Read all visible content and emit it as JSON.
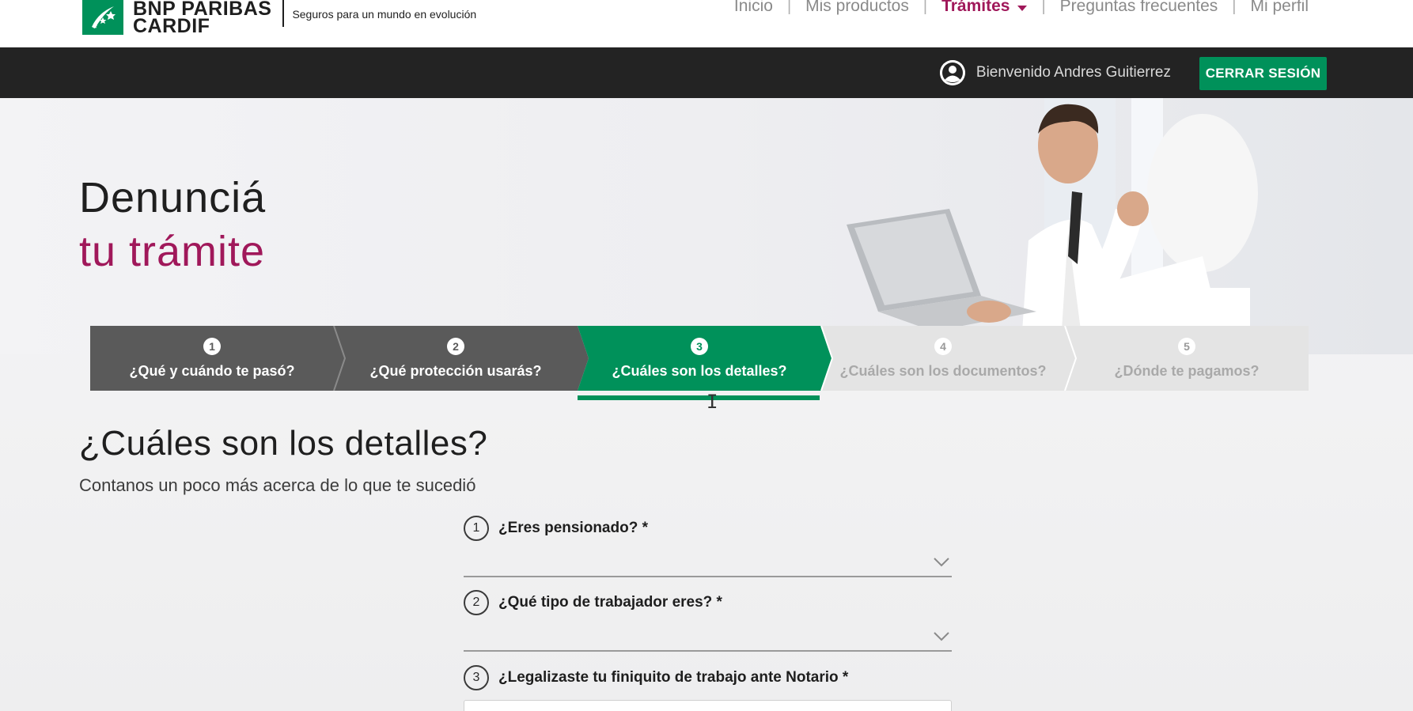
{
  "header": {
    "logo_line1": "BNP PARIBAS",
    "logo_line2": "CARDIF",
    "tagline": "Seguros para un mundo en evolución",
    "nav": [
      {
        "label": "Inicio",
        "active": false
      },
      {
        "label": "Mis productos",
        "active": false
      },
      {
        "label": "Trámites",
        "active": true
      },
      {
        "label": "Preguntas frecuentes",
        "active": false
      },
      {
        "label": "Mi perfil",
        "active": false
      }
    ]
  },
  "userbar": {
    "welcome": "Bienvenido Andres Guitierrez",
    "logout_label": "CERRAR SESIÓN"
  },
  "hero": {
    "title_line1": "Denunciá",
    "title_line2": "tu trámite"
  },
  "stepper": {
    "steps": [
      {
        "number": "1",
        "label": "¿Qué y cuándo te pasó?",
        "state": "done"
      },
      {
        "number": "2",
        "label": "¿Qué protección usarás?",
        "state": "done"
      },
      {
        "number": "3",
        "label": "¿Cuáles son los detalles?",
        "state": "current"
      },
      {
        "number": "4",
        "label": "¿Cuáles son los documentos?",
        "state": "todo"
      },
      {
        "number": "5",
        "label": "¿Dónde te pagamos?",
        "state": "todo"
      }
    ]
  },
  "content": {
    "title": "¿Cuáles son los detalles?",
    "subtitle": "Contanos un poco más acerca de lo que te sucedió",
    "questions": [
      {
        "number": "1",
        "label": "¿Eres pensionado? *"
      },
      {
        "number": "2",
        "label": "¿Qué tipo de trabajador eres? *"
      },
      {
        "number": "3",
        "label": "¿Legalizaste tu finiquito de trabajo ante Notario *"
      }
    ]
  },
  "colors": {
    "brand_green": "#00915a",
    "accent_magenta": "#a0185a",
    "step_done": "#5a5a5a",
    "step_todo": "#e4e4e4",
    "dark_bar": "#232323"
  }
}
